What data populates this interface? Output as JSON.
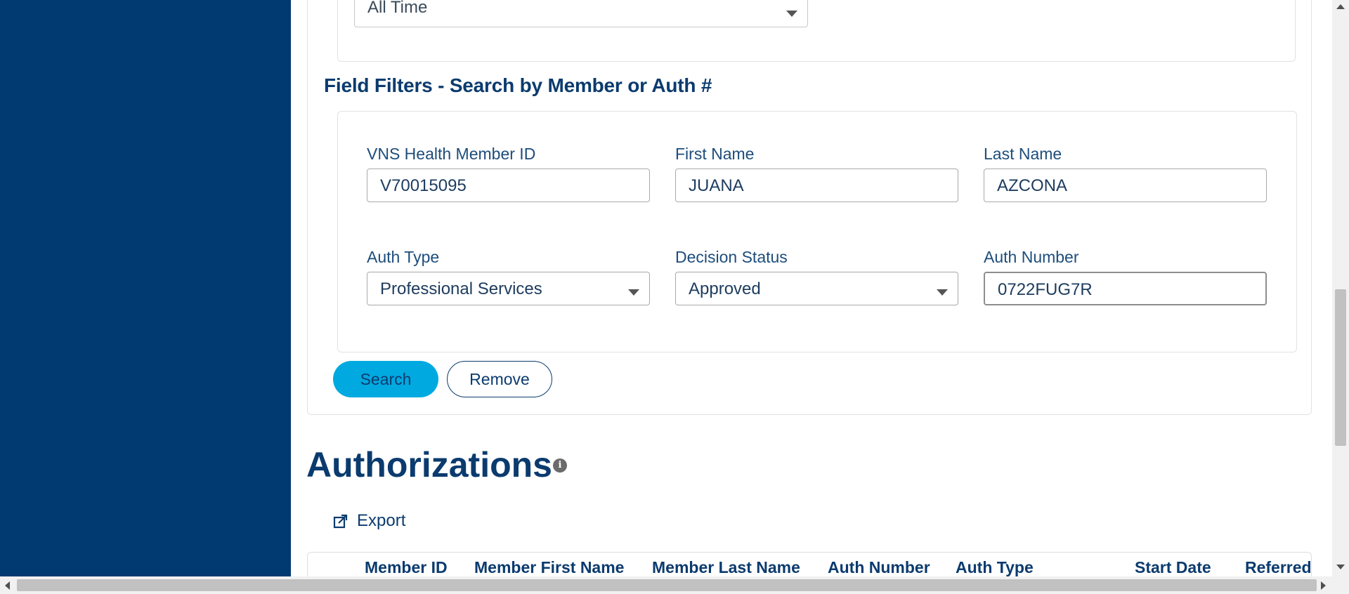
{
  "date_range": {
    "selected": "All Time"
  },
  "field_filters": {
    "heading": "Field Filters - Search by Member or Auth #",
    "member_id": {
      "label": "VNS Health Member ID",
      "value": "V70015095"
    },
    "first_name": {
      "label": "First Name",
      "value": "JUANA"
    },
    "last_name": {
      "label": "Last Name",
      "value": "AZCONA"
    },
    "auth_type": {
      "label": "Auth Type",
      "value": "Professional Services"
    },
    "decision_status": {
      "label": "Decision Status",
      "value": "Approved"
    },
    "auth_number": {
      "label": "Auth Number",
      "value": "0722FUG7R"
    }
  },
  "buttons": {
    "search": "Search",
    "remove": "Remove"
  },
  "authorizations": {
    "title": "Authorizations",
    "info_icon": "info-icon",
    "export_label": "Export",
    "columns": [
      "Member ID",
      "Member First Name",
      "Member Last Name",
      "Auth Number",
      "Auth Type",
      "Start Date",
      "Referred"
    ]
  },
  "colors": {
    "sidebar": "#003a70",
    "primary_text": "#0b3b6e",
    "search_button": "#00a9e0"
  }
}
